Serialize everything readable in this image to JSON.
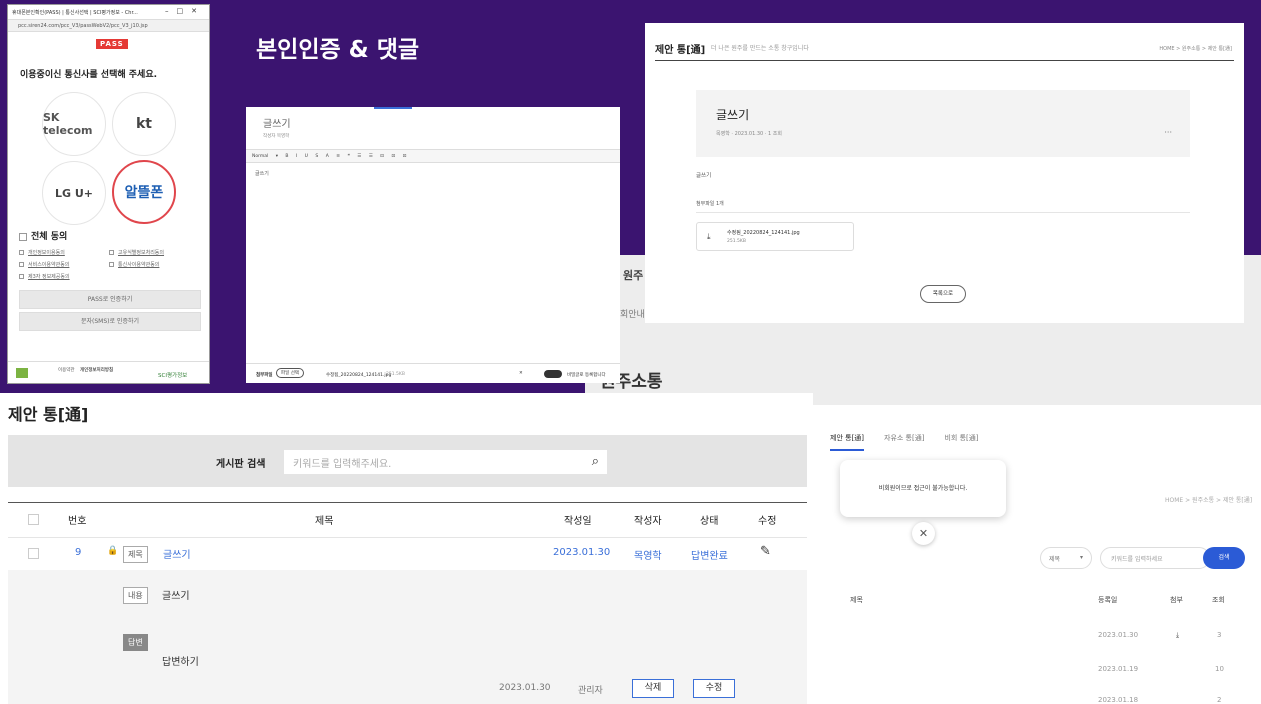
{
  "section_title": "본인인증 & 댓글",
  "pass_window": {
    "title": "휴대폰본인확인(PASS) | 통신사선택 | SCI평가정보 - Chr...",
    "url": "pcc.siren24.com/pcc_V3/passWebV2/pcc_V3_j10.jsp",
    "brand": "PASS",
    "question": "이용중이신 통신사를 선택해 주세요.",
    "carriers": [
      "SK telecom",
      "kt",
      "LG U+",
      "알뜰폰"
    ],
    "agree_all": "전체 동의",
    "agreements": [
      "개인정보이용동의",
      "고유식별정보처리동의",
      "서비스이용약관동의",
      "통신사이용약관동의",
      "제3자 정보제공동의"
    ],
    "buttons": [
      "PASS로 인증하기",
      "문자(SMS)로 인증하기"
    ],
    "footer": {
      "org": "개인정보처리방침",
      "note": "이용약관",
      "brand": "SCI평가정보"
    }
  },
  "editor_window": {
    "title": "글쓰기",
    "author_label": "작성자",
    "author": "목영학",
    "toolbar": "Normal ▾ B I U S A ≡ ❝ ☰ ☰ ⊡ ⊡ ⊡",
    "body": "글쓰기",
    "attach_label": "첨부파일",
    "attach_button": "파일 선택",
    "file_name": "수정됨_20220824_124141.jpg",
    "file_size": "251.5KB",
    "secret_label": "비밀글로 등록합니다"
  },
  "detail_window": {
    "title": "제안 통[通]",
    "subtitle": "더 나은 원주를 만드는 소통 창구입니다",
    "breadcrumb": "HOME > 원주소통 > 제안 통[通]",
    "post_title": "글쓰기",
    "meta": "목영학 · 2023.01.30 · 1 조회",
    "more": "···",
    "body": "글쓰기",
    "attach_label": "첨부파일 1개",
    "file_name": "수정됨_20220824_124141.jpg",
    "file_size": "251.5KB",
    "list_button": "목록으로"
  },
  "board": {
    "title": "제안 통[通]",
    "search_label": "게시판 검색",
    "search_placeholder": "키워드를 입력해주세요.",
    "columns": [
      "번호",
      "제목",
      "작성일",
      "작성자",
      "상태",
      "수정"
    ],
    "row": {
      "no": "9",
      "tag": "제목",
      "title": "글쓰기",
      "date": "2023.01.30",
      "author": "목영학",
      "status": "답변완료"
    },
    "content_tag": "내용",
    "content": "글쓰기",
    "answer_tag": "답변",
    "answer": "답변하기",
    "answer_date": "2023.01.30",
    "answer_author": "관리자",
    "delete_label": "삭제",
    "edit_label": "수정"
  },
  "background_page": {
    "header": "원주",
    "left_text": "회안내",
    "title": "원주소통",
    "tabs": [
      "제안 통[通]",
      "자유소 통[通]",
      "비회 통[通]"
    ],
    "breadcrumb": "HOME > 원주소통 > 제안 통[通]",
    "select": "제목",
    "search_placeholder": "키워드를 입력하세요",
    "search_button": "검색",
    "columns": [
      "제목",
      "등록일",
      "첨부",
      "조회"
    ],
    "rows": [
      {
        "date": "2023.01.30",
        "views": "3"
      },
      {
        "date": "2023.01.19",
        "views": "10"
      },
      {
        "date": "2023.01.18",
        "views": "2"
      }
    ]
  },
  "dialog": {
    "message": "비회원이므로 접근이 불가능합니다."
  },
  "colors": {
    "background": "#3b1470",
    "accent_blue": "#3a6fd8",
    "pass_red": "#e53935"
  }
}
